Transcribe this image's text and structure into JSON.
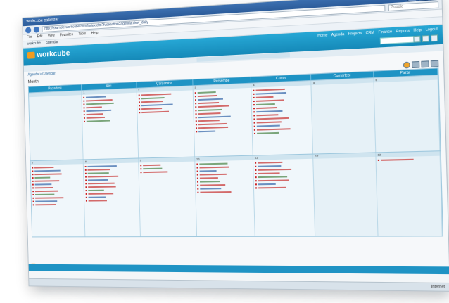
{
  "browser": {
    "title": "workcube calendar",
    "address": "http://example.workcube.com/index.cfm?fuseaction=agenda.view_daily",
    "search_placeholder": "Google",
    "menu": [
      "File",
      "Edit",
      "View",
      "Favorites",
      "Tools",
      "Help"
    ],
    "favorites": [
      "workcube",
      "calendar"
    ]
  },
  "app": {
    "logo_text": "workcube",
    "top_nav": [
      "Home",
      "Agenda",
      "Projects",
      "CRM",
      "Finance",
      "Reports",
      "Help",
      "Logout"
    ],
    "search_placeholder": "",
    "notice": "",
    "breadcrumb": "Agenda > Calendar",
    "month_label": "Month"
  },
  "calendar": {
    "days": [
      "Pazartesi",
      "Salı",
      "Çarşamba",
      "Perşembe",
      "Cuma",
      "Cumartesi",
      "Pazar"
    ],
    "weeks": [
      {
        "cells": [
          {
            "num": "",
            "events": 0,
            "weekend": false
          },
          {
            "num": "1",
            "events": 8,
            "weekend": false
          },
          {
            "num": "2",
            "events": 6,
            "weekend": false
          },
          {
            "num": "3",
            "events": 12,
            "weekend": false
          },
          {
            "num": "4",
            "events": 13,
            "weekend": false
          },
          {
            "num": "5",
            "events": 0,
            "weekend": true
          },
          {
            "num": "6",
            "events": 0,
            "weekend": true
          }
        ]
      },
      {
        "cells": [
          {
            "num": "7",
            "events": 12,
            "weekend": false
          },
          {
            "num": "8",
            "events": 11,
            "weekend": false
          },
          {
            "num": "9",
            "events": 3,
            "weekend": false
          },
          {
            "num": "10",
            "events": 9,
            "weekend": false
          },
          {
            "num": "11",
            "events": 8,
            "weekend": false
          },
          {
            "num": "12",
            "events": 0,
            "weekend": true
          },
          {
            "num": "13",
            "events": 1,
            "weekend": true
          }
        ]
      }
    ]
  },
  "status": {
    "bottom_label": "",
    "zone": "Internet"
  },
  "colors": {
    "accent": "#1e93c4",
    "event": "#d36a6a",
    "logo": "#f39c1f"
  }
}
